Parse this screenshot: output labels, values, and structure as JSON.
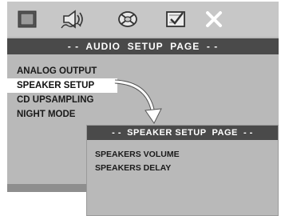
{
  "main_panel": {
    "title": "- -  AUDIO  SETUP  PAGE  - -",
    "icons": [
      {
        "name": "monitor-icon",
        "color": "#4a4a4a"
      },
      {
        "name": "speaker-sound-icon",
        "color": "#4a4a4a"
      },
      {
        "name": "dolby-disc-icon",
        "color": "#4a4a4a"
      },
      {
        "name": "preference-check-icon",
        "color": "#4a4a4a"
      },
      {
        "name": "close-icon",
        "color": "#ffffff"
      }
    ],
    "menu_items": [
      {
        "label": "ANALOG OUTPUT",
        "selected": false
      },
      {
        "label": "SPEAKER SETUP",
        "selected": true
      },
      {
        "label": "CD UPSAMPLING",
        "selected": false
      },
      {
        "label": "NIGHT MODE",
        "selected": false
      }
    ]
  },
  "sub_panel": {
    "title": "- -  SPEAKER SETUP  PAGE  - -",
    "items": [
      {
        "label": "SPEAKERS VOLUME"
      },
      {
        "label": "SPEAKERS DELAY"
      }
    ]
  },
  "colors": {
    "panel": "#b9b9b9",
    "title_bar": "#4a4a4a",
    "highlight": "#ffffff",
    "arrow": "#ffffff"
  }
}
